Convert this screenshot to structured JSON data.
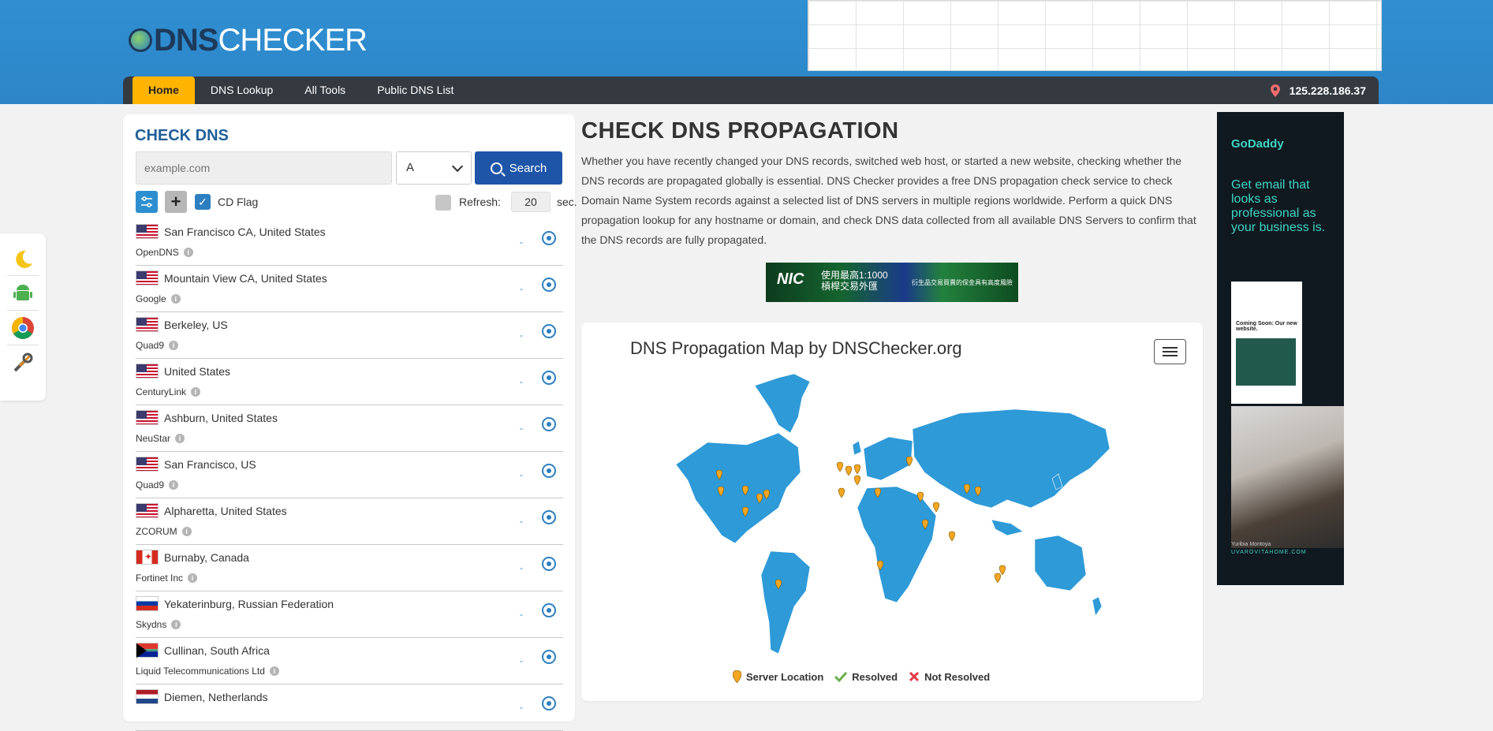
{
  "header": {
    "logo_main": "DNS",
    "logo_rest": "CHECKER"
  },
  "nav": {
    "items": [
      "Home",
      "DNS Lookup",
      "All Tools",
      "Public DNS List"
    ],
    "active": "Home",
    "ip": "125.228.186.37"
  },
  "side_tools": [
    "moon-icon",
    "android-icon",
    "chrome-icon",
    "tools-icon"
  ],
  "check": {
    "title": "CHECK DNS",
    "placeholder": "example.com",
    "record_type": "A",
    "search_label": "Search",
    "cd_flag_label": "CD Flag",
    "cd_flag_checked": true,
    "refresh_label": "Refresh:",
    "refresh_value": "20",
    "refresh_unit": "sec."
  },
  "servers": [
    {
      "location": "San Francisco CA, United States",
      "provider": "OpenDNS",
      "flag": "us",
      "result": "-"
    },
    {
      "location": "Mountain View CA, United States",
      "provider": "Google",
      "flag": "us",
      "result": "-"
    },
    {
      "location": "Berkeley, US",
      "provider": "Quad9",
      "flag": "us",
      "result": "-"
    },
    {
      "location": "United States",
      "provider": "CenturyLink",
      "flag": "us",
      "result": "-"
    },
    {
      "location": "Ashburn, United States",
      "provider": "NeuStar",
      "flag": "us",
      "result": "-"
    },
    {
      "location": "San Francisco, US",
      "provider": "Quad9",
      "flag": "us",
      "result": "-"
    },
    {
      "location": "Alpharetta, United States",
      "provider": "ZCORUM",
      "flag": "us",
      "result": "-"
    },
    {
      "location": "Burnaby, Canada",
      "provider": "Fortinet Inc",
      "flag": "ca",
      "result": "-"
    },
    {
      "location": "Yekaterinburg, Russian Federation",
      "provider": "Skydns",
      "flag": "ru",
      "result": "-"
    },
    {
      "location": "Cullinan, South Africa",
      "provider": "Liquid Telecommunications Ltd",
      "flag": "za",
      "result": "-"
    },
    {
      "location": "Diemen, Netherlands",
      "provider": "",
      "flag": "nl",
      "result": "-"
    }
  ],
  "main": {
    "title": "CHECK DNS PROPAGATION",
    "description": "Whether you have recently changed your DNS records, switched web host, or started a new website, checking whether the DNS records are propagated globally is essential. DNS Checker provides a free DNS propagation check service to check Domain Name System records against a selected list of DNS servers in multiple regions worldwide. Perform a quick DNS propagation lookup for any hostname or domain, and check DNS data collected from all available DNS Servers to confirm that the DNS records are fully propagated."
  },
  "banner_ad": {
    "brand": "NIC",
    "line1": "使用最高1:1000",
    "line2": "槓桿交易外匯",
    "line3": "衍生品交易買賣的保金具有高度風險"
  },
  "map": {
    "title": "DNS Propagation Map by DNSChecker.org",
    "land_color": "#2e9ad8",
    "marker_color": "#f5a623",
    "legend": [
      {
        "label": "Server Location",
        "icon": "pin-icon"
      },
      {
        "label": "Resolved",
        "icon": "check-icon"
      },
      {
        "label": "Not Resolved",
        "icon": "cross-icon"
      }
    ]
  },
  "side_ad": {
    "brand": "GoDaddy",
    "message": "Get email that looks as professional as your business is.",
    "mock_title": "Coming Soon: Our new website.",
    "person": "Yuribia Montoya",
    "url": "UVAROVITAHOME.COM"
  }
}
